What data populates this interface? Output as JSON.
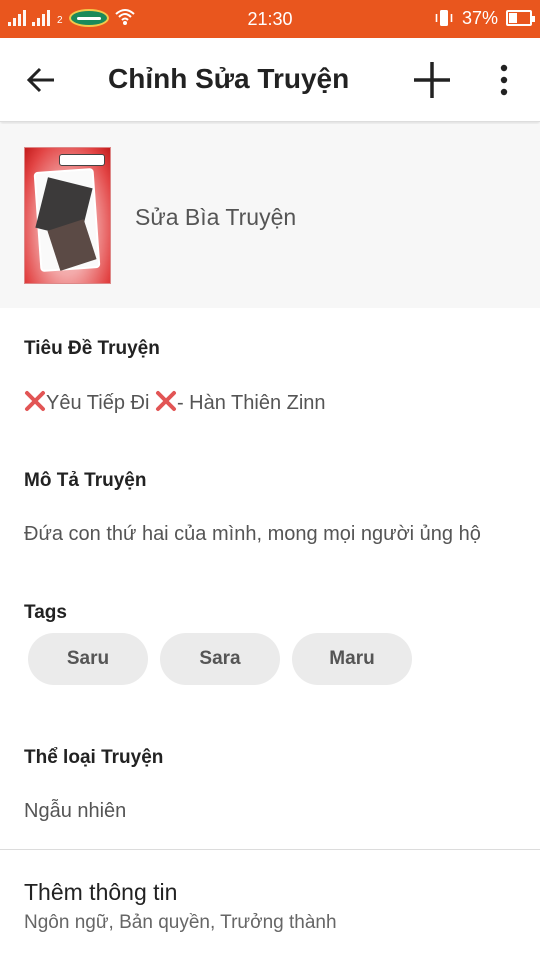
{
  "status_bar": {
    "sim_slot": "2",
    "time": "21:30",
    "battery_percent": "37%",
    "background_color": "#e9561e",
    "icons": [
      "signal-icon",
      "carrier-logo",
      "wifi-icon",
      "vibrate-icon",
      "battery-icon"
    ]
  },
  "app_bar": {
    "title": "Chỉnh Sửa Truyện",
    "icons": [
      "back-arrow-icon",
      "plus-icon",
      "more-vertical-icon"
    ]
  },
  "cover": {
    "label": "Sửa Bìa Truyện"
  },
  "story_title": {
    "label": "Tiêu Đề Truyện",
    "value_part1": "Yêu Tiếp Đi ",
    "value_part2": "-  Hàn Thiên Zinn",
    "accent_color": "#e25555"
  },
  "description": {
    "label": "Mô Tả Truyện",
    "value": "Đứa con thứ hai của mình, mong mọi người ủng hộ"
  },
  "tags": {
    "label": "Tags",
    "items": [
      "Saru",
      "Sara",
      "Maru"
    ]
  },
  "genre": {
    "label": "Thể loại Truyện",
    "value": "Ngẫu nhiên"
  },
  "more_info": {
    "title": "Thêm thông tin",
    "subtitle": "Ngôn ngữ, Bản quyền, Trưởng thành"
  }
}
